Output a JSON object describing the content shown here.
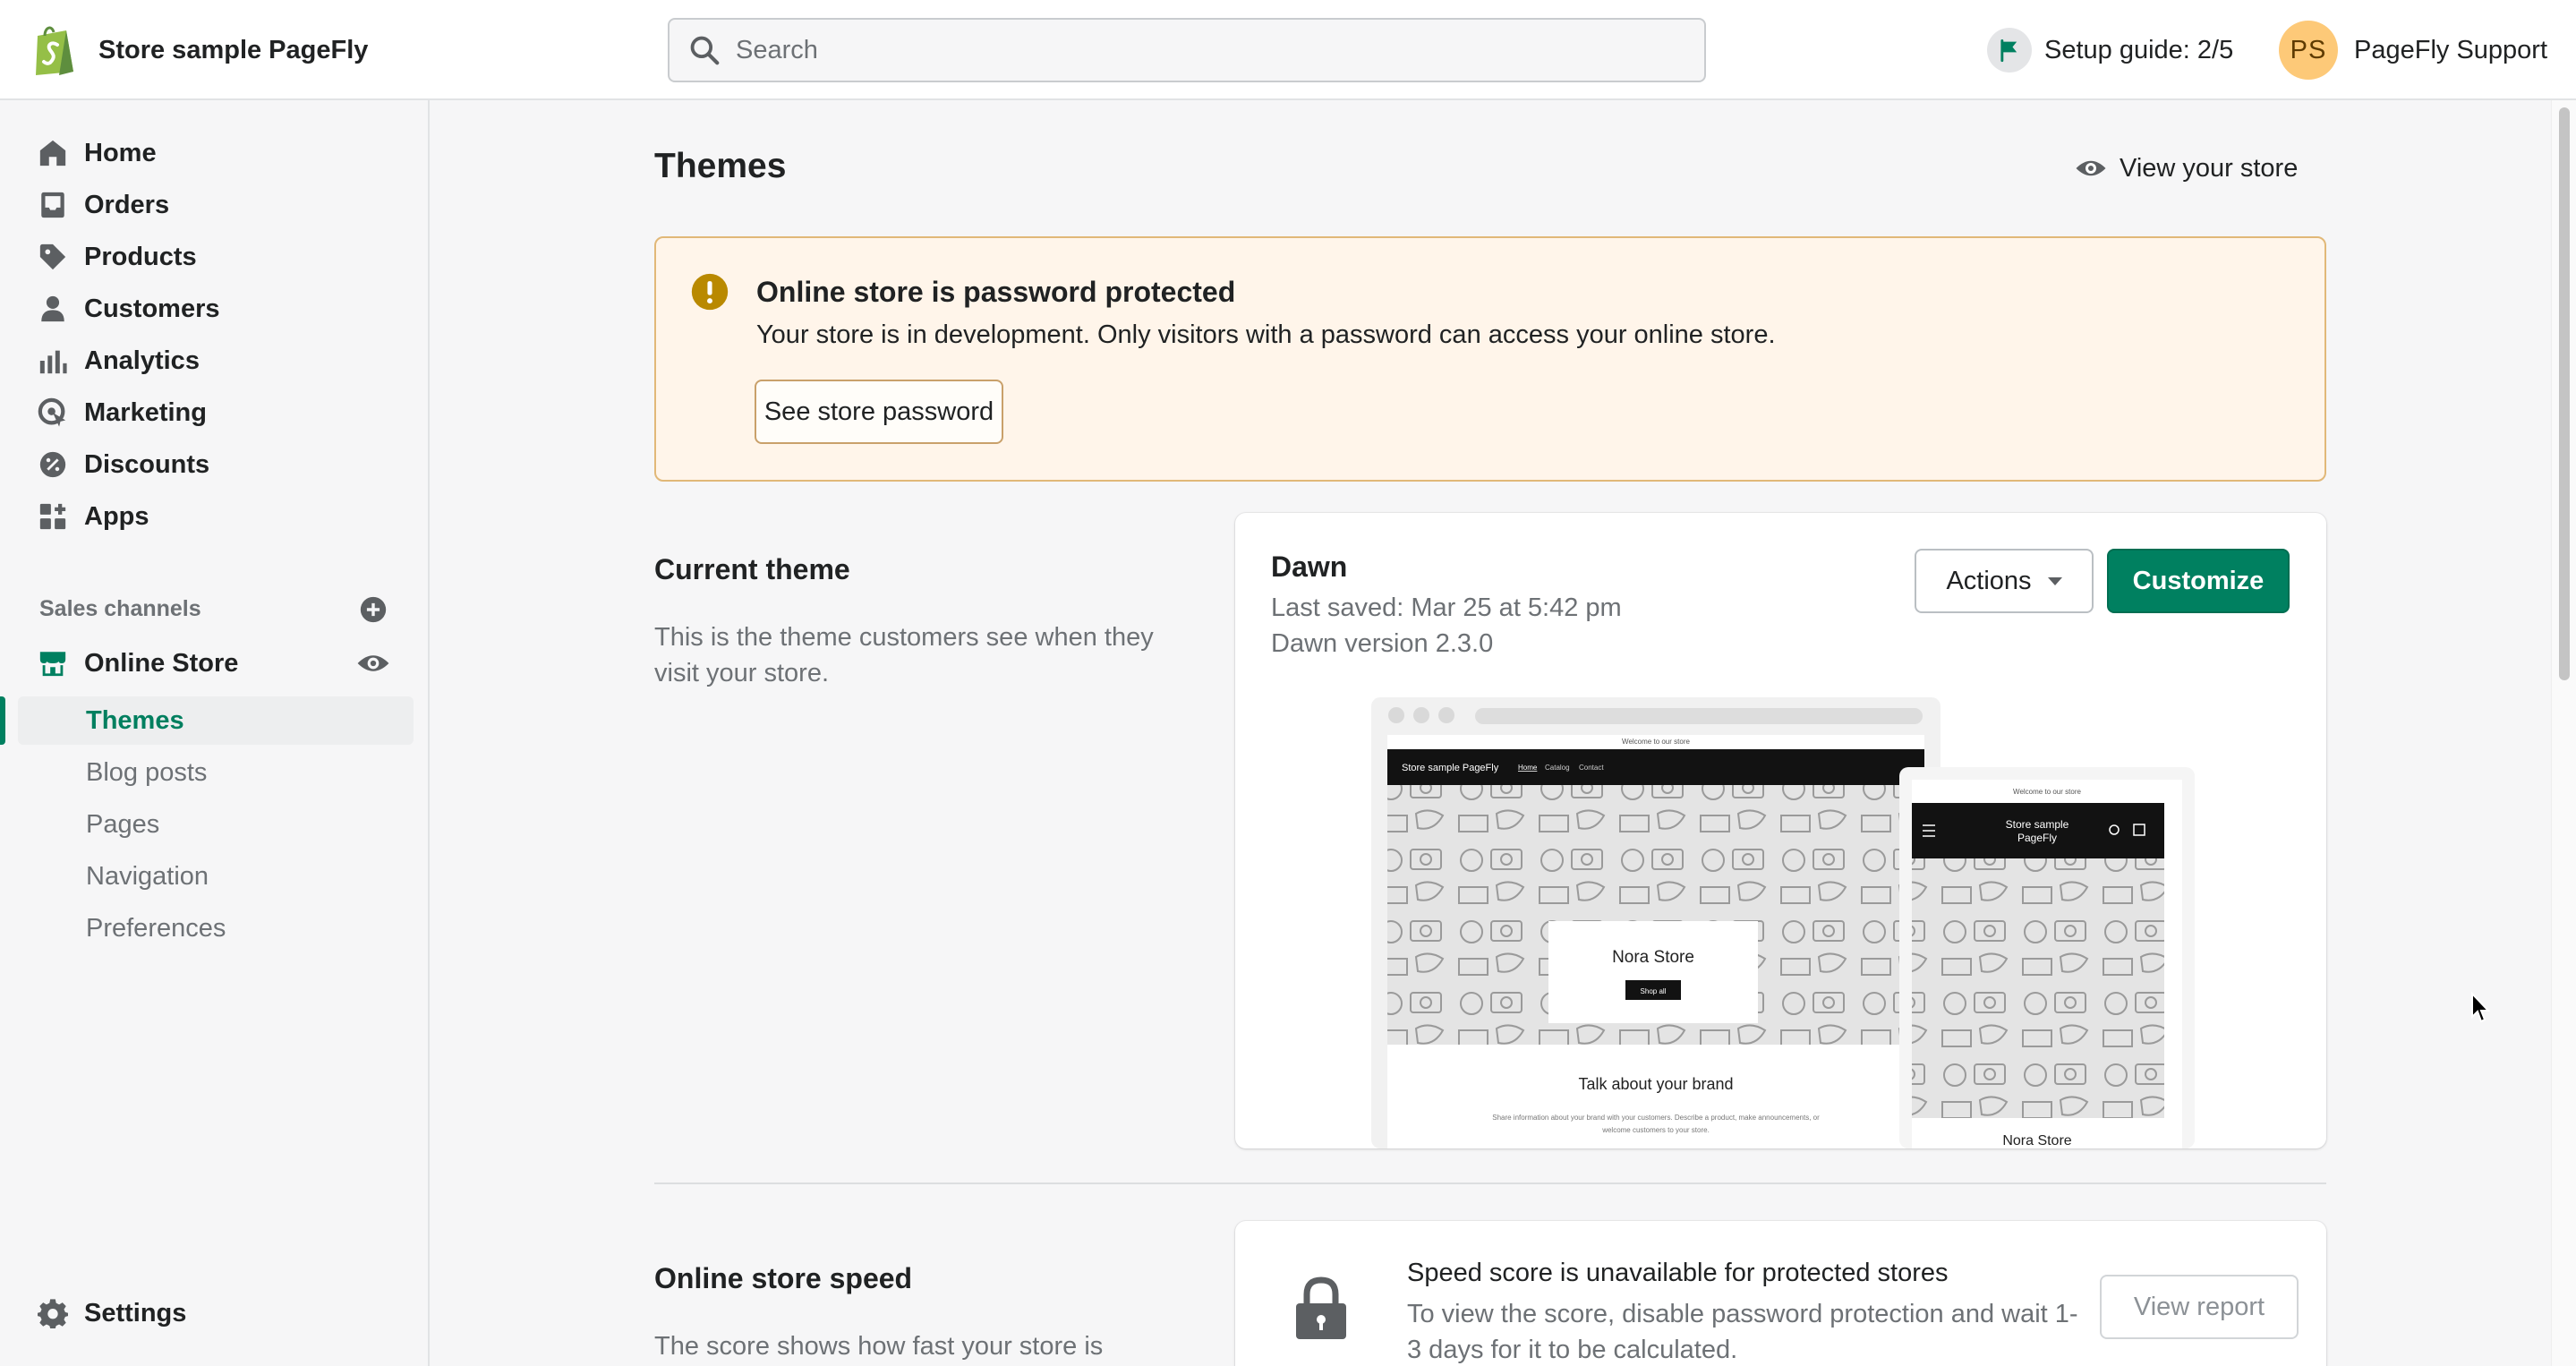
{
  "topbar": {
    "store_name": "Store sample PageFly",
    "search_placeholder": "Search",
    "setup_guide": "Setup guide: 2/5",
    "user_initials": "PS",
    "user_name": "PageFly Support"
  },
  "sidebar": {
    "items": [
      {
        "label": "Home",
        "icon": "home-icon"
      },
      {
        "label": "Orders",
        "icon": "orders-icon"
      },
      {
        "label": "Products",
        "icon": "tag-icon"
      },
      {
        "label": "Customers",
        "icon": "person-icon"
      },
      {
        "label": "Analytics",
        "icon": "bar-chart-icon"
      },
      {
        "label": "Marketing",
        "icon": "target-icon"
      },
      {
        "label": "Discounts",
        "icon": "discount-icon"
      },
      {
        "label": "Apps",
        "icon": "apps-icon"
      }
    ],
    "sales_channels_label": "Sales channels",
    "online_store_label": "Online Store",
    "online_store_sub": [
      "Themes",
      "Blog posts",
      "Pages",
      "Navigation",
      "Preferences"
    ],
    "active_sub": "Themes",
    "settings_label": "Settings"
  },
  "main": {
    "title": "Themes",
    "view_store": "View your store",
    "banner": {
      "title": "Online store is password protected",
      "text": "Your store is in development. Only visitors with a password can access your online store.",
      "button": "See store password"
    },
    "current_theme": {
      "section_title": "Current theme",
      "section_desc": "This is the theme customers see when they visit your store.",
      "name": "Dawn",
      "last_saved": "Last saved: Mar 25 at 5:42 pm",
      "version": "Dawn version 2.3.0",
      "actions_label": "Actions",
      "customize_label": "Customize",
      "preview": {
        "announcement": "Welcome to our store",
        "store_name": "Store sample PageFly",
        "store_name_mobile_1": "Store sample",
        "store_name_mobile_2": "PageFly",
        "nav_home": "Home",
        "nav_catalog": "Catalog",
        "nav_contact": "Contact",
        "hero_title": "Nora Store",
        "hero_button": "Shop all",
        "brand_title": "Talk about your brand",
        "brand_text_1": "Share information about your brand with your customers. Describe a product, make announcements, or",
        "brand_text_2": "welcome customers to your store.",
        "mobile_hero_title": "Nora Store"
      }
    },
    "speed": {
      "section_title": "Online store speed",
      "section_desc": "The score shows how fast your store is",
      "title": "Speed score is unavailable for protected stores",
      "text": "To view the score, disable password protection and wait 1-3 days for it to be calculated.",
      "button": "View report"
    }
  },
  "colors": {
    "accent": "#008060",
    "warning_bg": "#fff5ea",
    "warning_border": "#e1b878",
    "warning_icon": "#b98900"
  }
}
